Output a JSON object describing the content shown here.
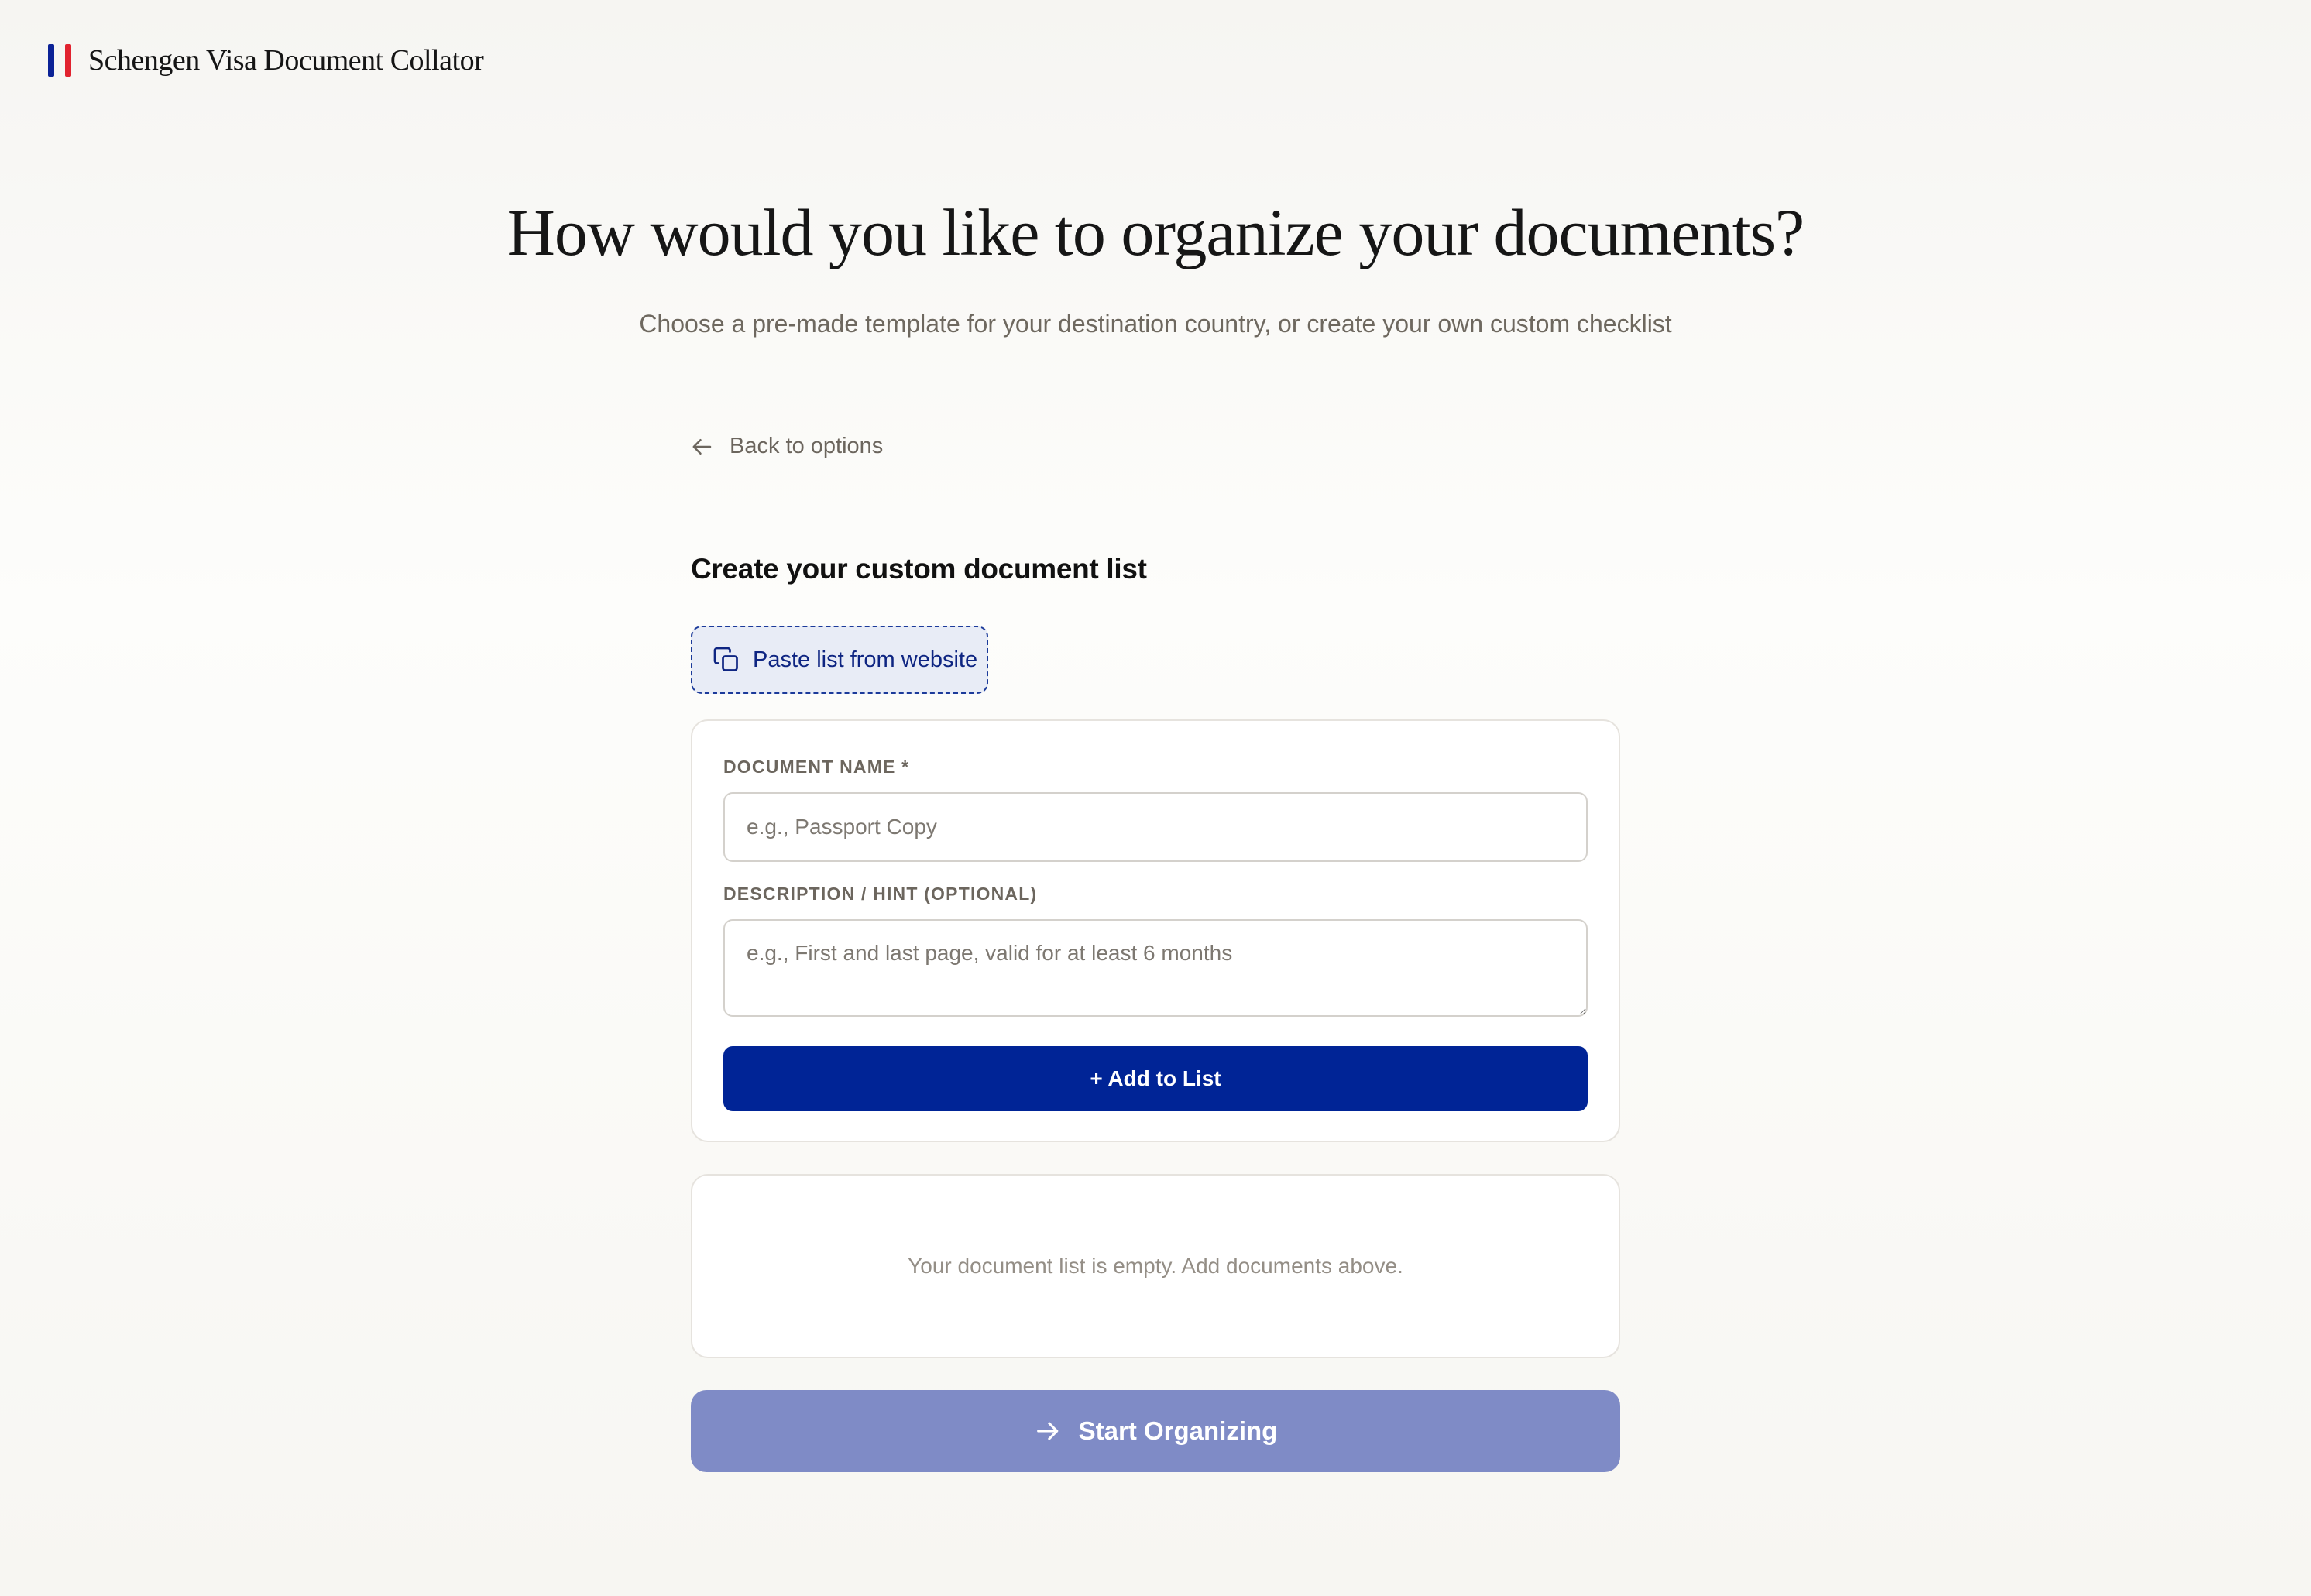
{
  "header": {
    "app_title": "Schengen Visa Document Collator",
    "flag_icon": "france-flag-icon",
    "flag_colors": [
      "#0b2296",
      "#e1232f"
    ]
  },
  "page": {
    "heading": "How would you like to organize your documents?",
    "subtitle": "Choose a pre-made template for your destination country, or create your own custom checklist"
  },
  "back_link": {
    "label": "Back to options",
    "icon": "arrow-left-icon"
  },
  "custom_list": {
    "title": "Create your custom document list",
    "paste_button": {
      "label": "Paste list from website",
      "icon": "copy-icon"
    },
    "form": {
      "name_label": "DOCUMENT NAME *",
      "name_value": "",
      "name_placeholder": "e.g., Passport Copy",
      "description_label": "DESCRIPTION / HINT (OPTIONAL)",
      "description_value": "",
      "description_placeholder": "e.g., First and last page, valid for at least 6 months",
      "add_button": "+ Add to List"
    },
    "empty_message": "Your document list is empty. Add documents above."
  },
  "start_button": {
    "label": "Start Organizing",
    "icon": "arrow-right-icon",
    "disabled": true
  },
  "colors": {
    "accent": "#002496",
    "accent_disabled": "#7f8bc6",
    "paste_bg": "#e8ecf6"
  }
}
